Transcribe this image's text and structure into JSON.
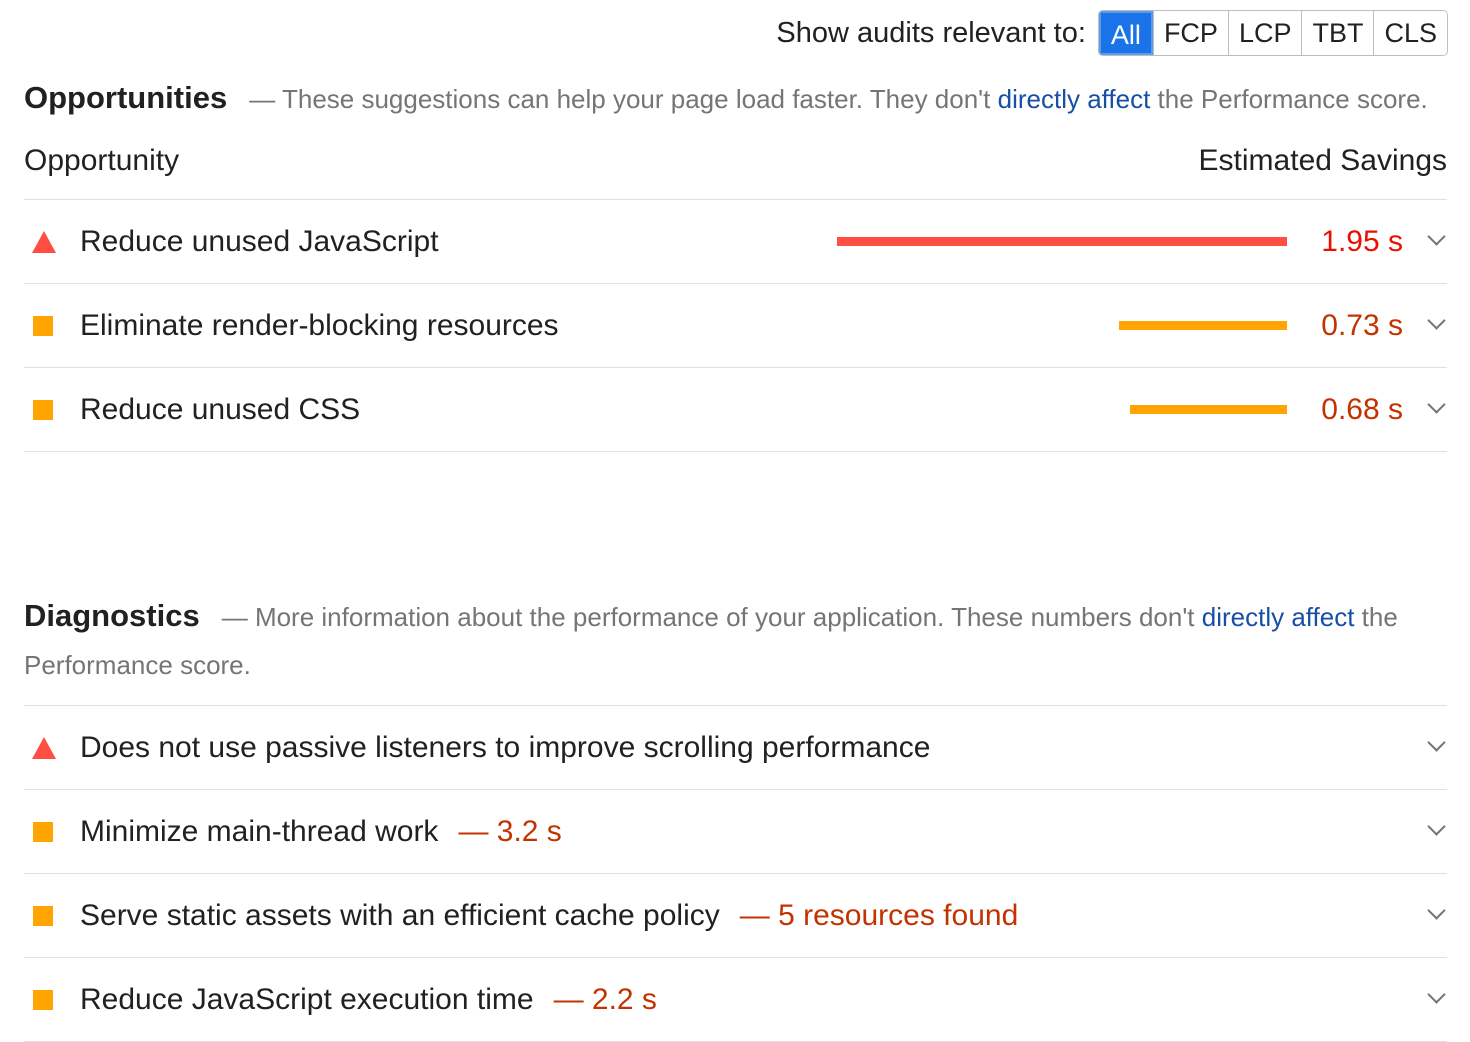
{
  "filter": {
    "label": "Show audits relevant to:",
    "options": [
      "All",
      "FCP",
      "LCP",
      "TBT",
      "CLS"
    ],
    "selected": "All"
  },
  "opportunities": {
    "title": "Opportunities",
    "desc_before": "— These suggestions can help your page load faster. They don't ",
    "desc_link": "directly affect",
    "desc_after": " the Performance score.",
    "col_left": "Opportunity",
    "col_right": "Estimated Savings",
    "items": [
      {
        "title": "Reduce unused JavaScript",
        "savings": "1.95 s",
        "seconds": 1.95,
        "rating": "fail",
        "bar_fraction": 1.0
      },
      {
        "title": "Eliminate render-blocking resources",
        "savings": "0.73 s",
        "seconds": 0.73,
        "rating": "average",
        "bar_fraction": 0.374
      },
      {
        "title": "Reduce unused CSS",
        "savings": "0.68 s",
        "seconds": 0.68,
        "rating": "average",
        "bar_fraction": 0.349
      }
    ]
  },
  "diagnostics": {
    "title": "Diagnostics",
    "desc_before": "— More information about the performance of your application. These numbers don't ",
    "desc_link": "directly affect",
    "desc_after": " the Performance score.",
    "items": [
      {
        "title": "Does not use passive listeners to improve scrolling performance",
        "value": "",
        "rating": "fail"
      },
      {
        "title": "Minimize main-thread work",
        "value": "— 3.2 s",
        "rating": "average"
      },
      {
        "title": "Serve static assets with an efficient cache policy",
        "value": "— 5 resources found",
        "rating": "average"
      },
      {
        "title": "Reduce JavaScript execution time",
        "value": "— 2.2 s",
        "rating": "average"
      }
    ]
  },
  "colors": {
    "fail": "#ff4e42",
    "average": "#ffa400",
    "link": "#174ea6",
    "selected_filter": "#1a73e8"
  },
  "icons": {
    "fail": "red-triangle-icon",
    "average": "orange-square-icon",
    "expand": "chevron-down-icon"
  }
}
